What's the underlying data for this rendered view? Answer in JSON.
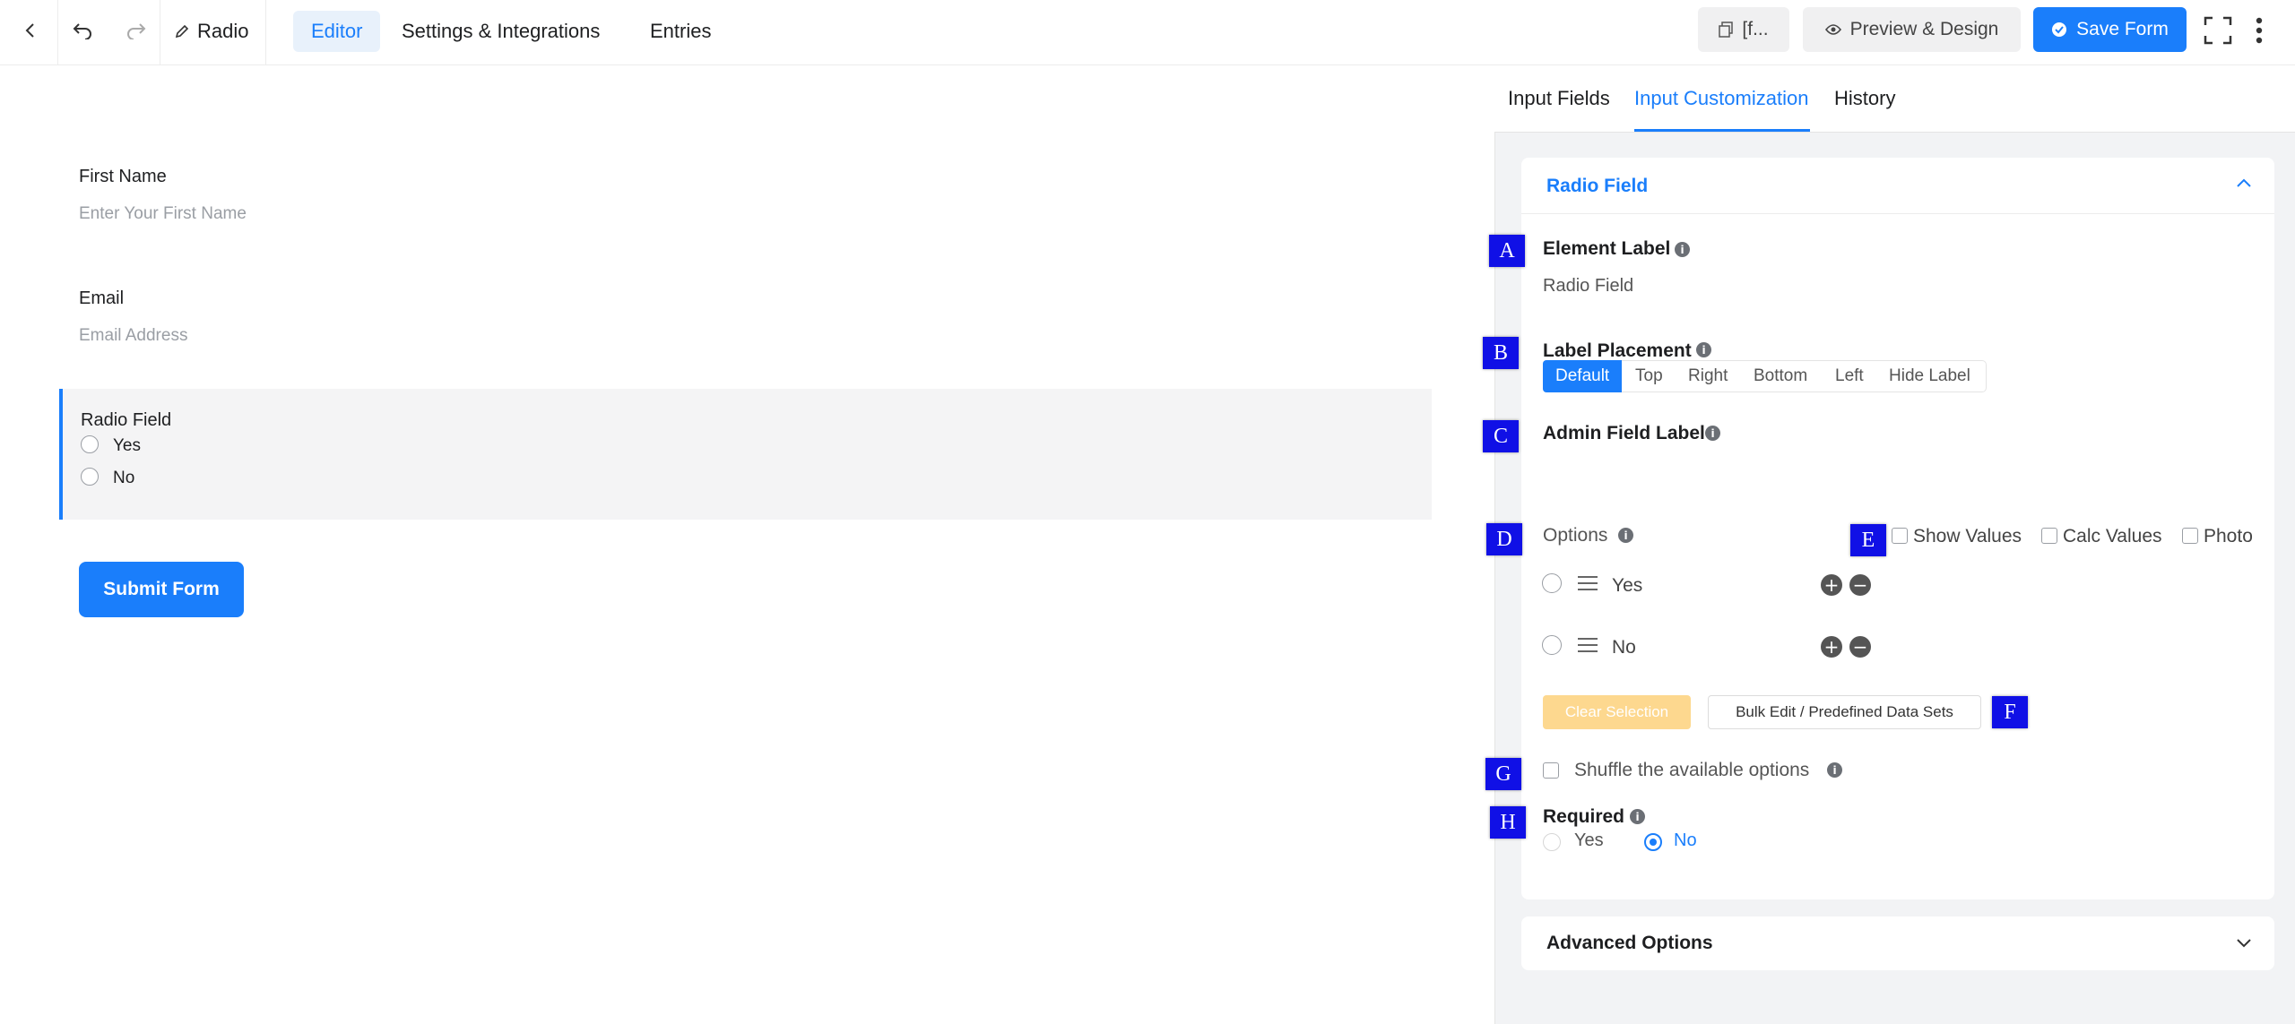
{
  "topbar": {
    "form_name": "Radio",
    "tabs": [
      "Editor",
      "Settings & Integrations",
      "Entries"
    ],
    "shortcode_label": "[f...",
    "preview_label": "Preview & Design",
    "save_label": "Save Form"
  },
  "form": {
    "fields": [
      {
        "label": "First Name",
        "placeholder": "Enter Your First Name"
      },
      {
        "label": "Email",
        "placeholder": "Email Address"
      }
    ],
    "radio": {
      "label": "Radio Field",
      "options": [
        "Yes",
        "No"
      ]
    },
    "submit_label": "Submit Form"
  },
  "panel": {
    "tabs": [
      "Input Fields",
      "Input Customization",
      "History"
    ],
    "section_title": "Radio Field",
    "element_label": {
      "title": "Element Label",
      "value": "Radio Field"
    },
    "label_placement": {
      "title": "Label Placement",
      "options": [
        "Default",
        "Top",
        "Right",
        "Bottom",
        "Left",
        "Hide Label"
      ],
      "selected": "Default"
    },
    "admin_field_label": {
      "title": "Admin Field Label",
      "value": ""
    },
    "options": {
      "title": "Options",
      "toggles": [
        "Show Values",
        "Calc Values",
        "Photo"
      ],
      "items": [
        "Yes",
        "No"
      ],
      "clear_label": "Clear Selection",
      "bulk_label": "Bulk Edit / Predefined Data Sets"
    },
    "shuffle_label": "Shuffle the available options",
    "required": {
      "title": "Required",
      "options": [
        "Yes",
        "No"
      ],
      "selected": "No"
    },
    "advanced_label": "Advanced Options"
  },
  "markers": [
    "A",
    "B",
    "C",
    "D",
    "E",
    "F",
    "G",
    "H"
  ],
  "colors": {
    "accent": "#1a7efb",
    "marker": "#1010e6",
    "clear_button": "#fdd88f"
  }
}
